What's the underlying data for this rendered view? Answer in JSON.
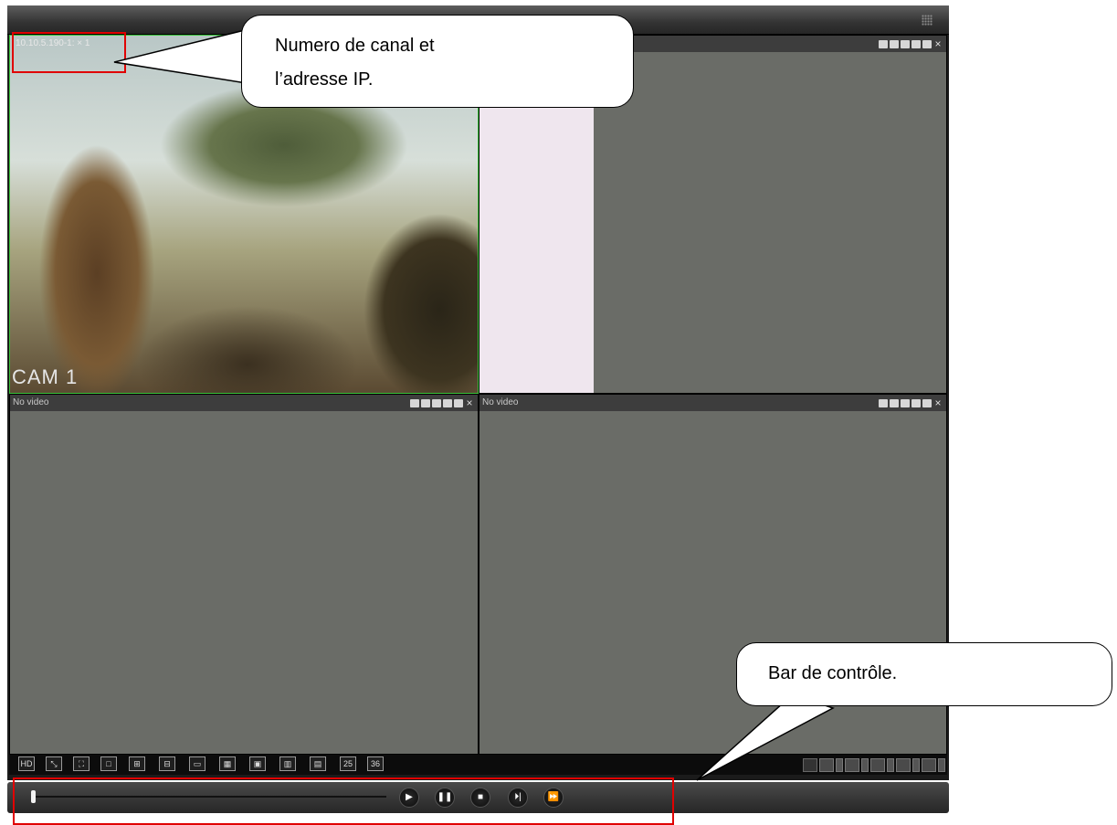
{
  "video_panes": [
    {
      "header": "10.10.5.190-1: × 1",
      "label": "CAM 1"
    },
    {
      "header": ""
    },
    {
      "header": "No video"
    },
    {
      "header": "No video"
    }
  ],
  "pane_close": "×",
  "layout_buttons": [
    "HD",
    "⤡",
    "⛶",
    "□",
    "⊞",
    "⊟",
    "▭",
    "▦",
    "▣",
    "▥",
    "▤",
    "25",
    "36"
  ],
  "controls": [
    "▶",
    "❚❚",
    "■",
    "⏵|",
    "⏩"
  ],
  "callouts": {
    "channel": {
      "line1": "Numero de canal et",
      "line2": "l’adresse IP."
    },
    "control_bar": "Bar de contrôle."
  },
  "colors": {
    "accent_green": "#39c23a",
    "annotation_red": "#e00000",
    "pane_bg": "#6a6c67"
  },
  "playback_progress": 0.0
}
